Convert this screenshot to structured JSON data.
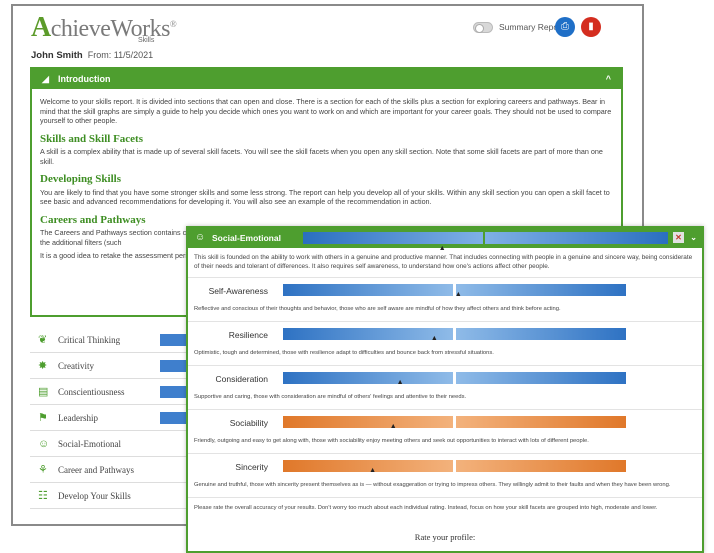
{
  "app": {
    "logo_text": "chieveWorks",
    "logo_mark": "A",
    "logo_trademark": "®",
    "logo_sub": "Skills"
  },
  "user": {
    "name": "John Smith",
    "from_label": "From: 11/5/2021"
  },
  "header": {
    "summary_label": "Summary Report"
  },
  "intro": {
    "title": "Introduction",
    "p1": "Welcome to your skills report. It is divided into sections that can open and close. There is a section for each of the skills plus a section for exploring careers and pathways. Bear in mind that the skill graphs are simply a guide to help you decide which ones you want to work on and which are important for your career goals. They should not be used to compare yourself to other people.",
    "h_skills": "Skills and Skill Facets",
    "p_skills": "A skill is a complex ability that is made up of several skill facets. You will see the skill facets when you open any skill section. Note that some skill facets are part of more than one skill.",
    "h_dev": "Developing Skills",
    "p_dev": "You are likely to find that you have some stronger skills and some less strong. The report can help you develop all of your skills. Within any skill section you can open a skill facet to see basic and advanced recommendations for developing it. You will also see an example of the recommendation in action.",
    "h_careers": "Careers and Pathways",
    "p_careers": "The Careers and Pathways section contains careers that match your skill profile. You can use the additional filters (such as education level) to explore the careers you want. Use the additional filters (such",
    "p_retake": "It is a good idea to retake the assessment periodically as your skills may change as well."
  },
  "skills": [
    {
      "label": "Critical Thinking",
      "icon": "brain-icon"
    },
    {
      "label": "Creativity",
      "icon": "lightbulb-icon"
    },
    {
      "label": "Conscientiousness",
      "icon": "checklist-icon"
    },
    {
      "label": "Leadership",
      "icon": "flag-icon"
    },
    {
      "label": "Social-Emotional",
      "icon": "people-icon"
    },
    {
      "label": "Career and Pathways",
      "icon": "pathway-icon"
    },
    {
      "label": "Develop Your Skills",
      "icon": "tools-icon"
    }
  ],
  "panel": {
    "title": "Social-Emotional",
    "description": "This skill is founded on the ability to work with others in a genuine and productive manner. That includes connecting with people in a genuine and sincere way, being considerate of their needs and tolerant of differences. It also requires self awareness, to understand how one's actions affect other people.",
    "facets": [
      {
        "name": "Self-Awareness",
        "desc": "Reflective and conscious of their thoughts and behavior, those who are self aware are mindful of how they affect others and think before acting.",
        "color": "blue",
        "level": 0.51
      },
      {
        "name": "Resilience",
        "desc": "Optimistic, tough and determined, those with resilience adapt to difficulties and bounce back from stressful situations.",
        "color": "blue",
        "level": 0.44
      },
      {
        "name": "Consideration",
        "desc": "Supportive and caring, those with consideration are mindful of others' feelings and attentive to their needs.",
        "color": "blue",
        "level": 0.34
      },
      {
        "name": "Sociability",
        "desc": "Friendly, outgoing and easy to get along with, those with sociability enjoy meeting others and seek out opportunities to interact with lots of different people.",
        "color": "orange",
        "level": 0.32
      },
      {
        "name": "Sincerity",
        "desc": "Genuine and truthful, those with sincerity present themselves as is — without exaggeration or trying to impress others. They willingly admit to their faults and when they have been wrong.",
        "color": "orange",
        "level": 0.26
      }
    ],
    "overall_level": 0.38,
    "note": "Please rate the overall accuracy of your results. Don't worry too much about each individual rating. Instead, focus on how your skill facets are grouped into high, moderate and lower.",
    "rate_label": "Rate your profile:"
  },
  "colors": {
    "green": "#4e9e2f",
    "blue": "#2e72c3",
    "orange": "#e0782a",
    "red": "#d42d1f"
  }
}
